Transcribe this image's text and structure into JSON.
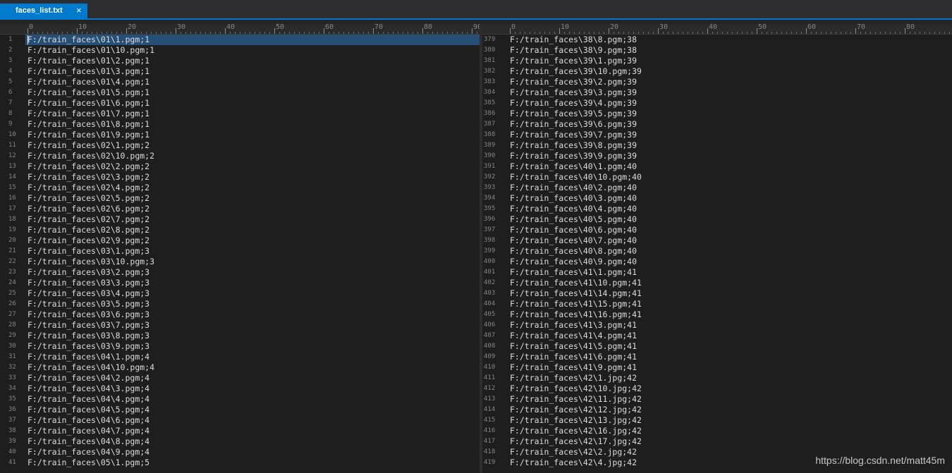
{
  "editor": {
    "tab": {
      "filename": "faces_list.txt",
      "close_symbol": "×"
    },
    "ruler_labels": [
      "0",
      "10",
      "20",
      "30",
      "40",
      "50",
      "60",
      "70",
      "80",
      "90"
    ],
    "left_pane": {
      "lines": [
        {
          "n": "1",
          "text": "F:/train_faces\\01\\1.pgm;1"
        },
        {
          "n": "2",
          "text": "F:/train_faces\\01\\10.pgm;1"
        },
        {
          "n": "3",
          "text": "F:/train_faces\\01\\2.pgm;1"
        },
        {
          "n": "4",
          "text": "F:/train_faces\\01\\3.pgm;1"
        },
        {
          "n": "5",
          "text": "F:/train_faces\\01\\4.pgm;1"
        },
        {
          "n": "6",
          "text": "F:/train_faces\\01\\5.pgm;1"
        },
        {
          "n": "7",
          "text": "F:/train_faces\\01\\6.pgm;1"
        },
        {
          "n": "8",
          "text": "F:/train_faces\\01\\7.pgm;1"
        },
        {
          "n": "9",
          "text": "F:/train_faces\\01\\8.pgm;1"
        },
        {
          "n": "10",
          "text": "F:/train_faces\\01\\9.pgm;1"
        },
        {
          "n": "11",
          "text": "F:/train_faces\\02\\1.pgm;2"
        },
        {
          "n": "12",
          "text": "F:/train_faces\\02\\10.pgm;2"
        },
        {
          "n": "13",
          "text": "F:/train_faces\\02\\2.pgm;2"
        },
        {
          "n": "14",
          "text": "F:/train_faces\\02\\3.pgm;2"
        },
        {
          "n": "15",
          "text": "F:/train_faces\\02\\4.pgm;2"
        },
        {
          "n": "16",
          "text": "F:/train_faces\\02\\5.pgm;2"
        },
        {
          "n": "17",
          "text": "F:/train_faces\\02\\6.pgm;2"
        },
        {
          "n": "18",
          "text": "F:/train_faces\\02\\7.pgm;2"
        },
        {
          "n": "19",
          "text": "F:/train_faces\\02\\8.pgm;2"
        },
        {
          "n": "20",
          "text": "F:/train_faces\\02\\9.pgm;2"
        },
        {
          "n": "21",
          "text": "F:/train_faces\\03\\1.pgm;3"
        },
        {
          "n": "22",
          "text": "F:/train_faces\\03\\10.pgm;3"
        },
        {
          "n": "23",
          "text": "F:/train_faces\\03\\2.pgm;3"
        },
        {
          "n": "24",
          "text": "F:/train_faces\\03\\3.pgm;3"
        },
        {
          "n": "25",
          "text": "F:/train_faces\\03\\4.pgm;3"
        },
        {
          "n": "26",
          "text": "F:/train_faces\\03\\5.pgm;3"
        },
        {
          "n": "27",
          "text": "F:/train_faces\\03\\6.pgm;3"
        },
        {
          "n": "28",
          "text": "F:/train_faces\\03\\7.pgm;3"
        },
        {
          "n": "29",
          "text": "F:/train_faces\\03\\8.pgm;3"
        },
        {
          "n": "30",
          "text": "F:/train_faces\\03\\9.pgm;3"
        },
        {
          "n": "31",
          "text": "F:/train_faces\\04\\1.pgm;4"
        },
        {
          "n": "32",
          "text": "F:/train_faces\\04\\10.pgm;4"
        },
        {
          "n": "33",
          "text": "F:/train_faces\\04\\2.pgm;4"
        },
        {
          "n": "34",
          "text": "F:/train_faces\\04\\3.pgm;4"
        },
        {
          "n": "35",
          "text": "F:/train_faces\\04\\4.pgm;4"
        },
        {
          "n": "36",
          "text": "F:/train_faces\\04\\5.pgm;4"
        },
        {
          "n": "37",
          "text": "F:/train_faces\\04\\6.pgm;4"
        },
        {
          "n": "38",
          "text": "F:/train_faces\\04\\7.pgm;4"
        },
        {
          "n": "39",
          "text": "F:/train_faces\\04\\8.pgm;4"
        },
        {
          "n": "40",
          "text": "F:/train_faces\\04\\9.pgm;4"
        },
        {
          "n": "41",
          "text": "F:/train_faces\\05\\1.pgm;5"
        }
      ]
    },
    "right_pane": {
      "lines": [
        {
          "n": "379",
          "text": "F:/train_faces\\38\\8.pgm;38"
        },
        {
          "n": "380",
          "text": "F:/train_faces\\38\\9.pgm;38"
        },
        {
          "n": "381",
          "text": "F:/train_faces\\39\\1.pgm;39"
        },
        {
          "n": "382",
          "text": "F:/train_faces\\39\\10.pgm;39"
        },
        {
          "n": "383",
          "text": "F:/train_faces\\39\\2.pgm;39"
        },
        {
          "n": "384",
          "text": "F:/train_faces\\39\\3.pgm;39"
        },
        {
          "n": "385",
          "text": "F:/train_faces\\39\\4.pgm;39"
        },
        {
          "n": "386",
          "text": "F:/train_faces\\39\\5.pgm;39"
        },
        {
          "n": "387",
          "text": "F:/train_faces\\39\\6.pgm;39"
        },
        {
          "n": "388",
          "text": "F:/train_faces\\39\\7.pgm;39"
        },
        {
          "n": "389",
          "text": "F:/train_faces\\39\\8.pgm;39"
        },
        {
          "n": "390",
          "text": "F:/train_faces\\39\\9.pgm;39"
        },
        {
          "n": "391",
          "text": "F:/train_faces\\40\\1.pgm;40"
        },
        {
          "n": "392",
          "text": "F:/train_faces\\40\\10.pgm;40"
        },
        {
          "n": "393",
          "text": "F:/train_faces\\40\\2.pgm;40"
        },
        {
          "n": "394",
          "text": "F:/train_faces\\40\\3.pgm;40"
        },
        {
          "n": "395",
          "text": "F:/train_faces\\40\\4.pgm;40"
        },
        {
          "n": "396",
          "text": "F:/train_faces\\40\\5.pgm;40"
        },
        {
          "n": "397",
          "text": "F:/train_faces\\40\\6.pgm;40"
        },
        {
          "n": "398",
          "text": "F:/train_faces\\40\\7.pgm;40"
        },
        {
          "n": "399",
          "text": "F:/train_faces\\40\\8.pgm;40"
        },
        {
          "n": "400",
          "text": "F:/train_faces\\40\\9.pgm;40"
        },
        {
          "n": "401",
          "text": "F:/train_faces\\41\\1.pgm;41"
        },
        {
          "n": "402",
          "text": "F:/train_faces\\41\\10.pgm;41"
        },
        {
          "n": "403",
          "text": "F:/train_faces\\41\\14.pgm;41"
        },
        {
          "n": "404",
          "text": "F:/train_faces\\41\\15.pgm;41"
        },
        {
          "n": "405",
          "text": "F:/train_faces\\41\\16.pgm;41"
        },
        {
          "n": "406",
          "text": "F:/train_faces\\41\\3.pgm;41"
        },
        {
          "n": "407",
          "text": "F:/train_faces\\41\\4.pgm;41"
        },
        {
          "n": "408",
          "text": "F:/train_faces\\41\\5.pgm;41"
        },
        {
          "n": "409",
          "text": "F:/train_faces\\41\\6.pgm;41"
        },
        {
          "n": "410",
          "text": "F:/train_faces\\41\\9.pgm;41"
        },
        {
          "n": "411",
          "text": "F:/train_faces\\42\\1.jpg;42"
        },
        {
          "n": "412",
          "text": "F:/train_faces\\42\\10.jpg;42"
        },
        {
          "n": "413",
          "text": "F:/train_faces\\42\\11.jpg;42"
        },
        {
          "n": "414",
          "text": "F:/train_faces\\42\\12.jpg;42"
        },
        {
          "n": "415",
          "text": "F:/train_faces\\42\\13.jpg;42"
        },
        {
          "n": "416",
          "text": "F:/train_faces\\42\\16.jpg;42"
        },
        {
          "n": "417",
          "text": "F:/train_faces\\42\\17.jpg;42"
        },
        {
          "n": "418",
          "text": "F:/train_faces\\42\\2.jpg;42"
        },
        {
          "n": "419",
          "text": "F:/train_faces\\42\\4.jpg;42"
        }
      ]
    }
  },
  "watermark": "https://blog.csdn.net/matt45m",
  "colors": {
    "accent": "#007acc",
    "background": "#1e1e1e",
    "text": "#dcdcdc",
    "line_number": "#858585",
    "current_line": "#264f78"
  }
}
